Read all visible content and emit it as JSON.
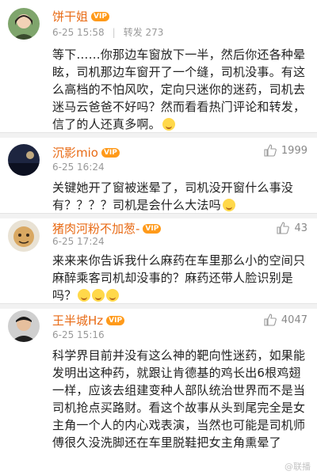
{
  "comments": [
    {
      "name": "饼干姐",
      "vip_badge": "VIP",
      "time": "6-25 15:58",
      "repost_label": "转发",
      "repost_count": "273",
      "text": "等下……你那边车窗放下一半，然后你还各种晕眩，司机那边车窗开了一个缝，司机没事。有这么高档的不怕风吹，定向只迷你的迷药，司机去迷马云爸爸不好吗？然而看看热门评论和转发，信了的人还真多啊。"
    },
    {
      "name": "沉影mio",
      "vip_badge": "VIP",
      "time": "6-25 16:24",
      "likes": "1999",
      "text": "关键她开了窗被迷晕了，司机没开窗什么事没有？？？？司机是会什么大法吗"
    },
    {
      "name": "猪肉河粉不加葱-",
      "vip_badge": "VIP",
      "time": "6-25 17:24",
      "likes": "43",
      "text": "来来来你告诉我什么麻药在车里那么小的空间只麻醉乘客司机却没事的？麻药还带人脸识别是吗？"
    },
    {
      "name": "王半城Hz",
      "vip_badge": "VIP",
      "time": "6-25 15:16",
      "likes": "4047",
      "text": "科学界目前并没有这么神的靶向性迷药，如果能发明出这种药，就跟让肯德基的鸡长出6根鸡翅一样，应该去组建变种人部队统治世界而不是当司机抢点买路财。看这个故事从头到尾完全是女主角一个人的内心戏表演，当然也可能是司机师傅很久没洗脚还在车里脱鞋把女主角熏晕了"
    }
  ],
  "watermark": "@联播",
  "icons": [
    "thumb-up-icon",
    "laugh-emoji-icon",
    "vip-badge-icon"
  ]
}
